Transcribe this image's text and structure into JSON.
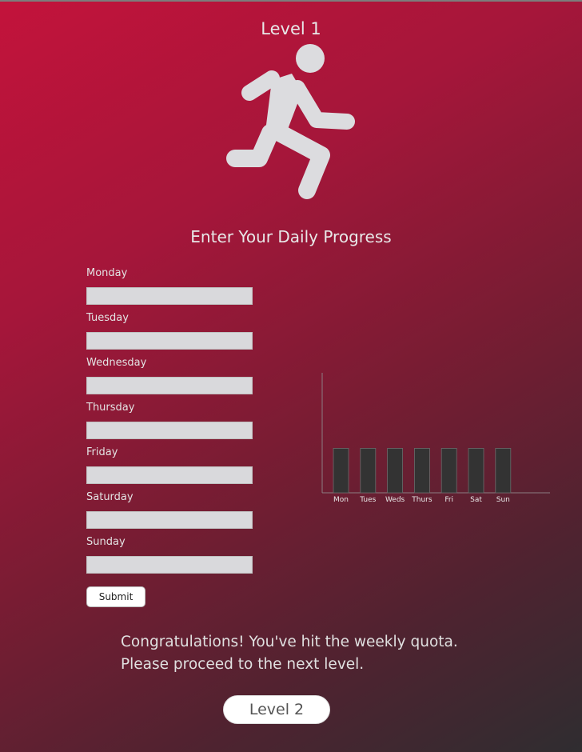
{
  "level_title": "Level 1",
  "icon": "running-person-icon",
  "heading": "Enter Your Daily Progress",
  "form": {
    "days": [
      {
        "label": "Monday",
        "value": ""
      },
      {
        "label": "Tuesday",
        "value": ""
      },
      {
        "label": "Wednesday",
        "value": ""
      },
      {
        "label": "Thursday",
        "value": ""
      },
      {
        "label": "Friday",
        "value": ""
      },
      {
        "label": "Saturday",
        "value": ""
      },
      {
        "label": "Sunday",
        "value": ""
      }
    ],
    "submit_label": "Submit"
  },
  "chart_data": {
    "type": "bar",
    "categories": [
      "Mon",
      "Tues",
      "Weds",
      "Thurs",
      "Fri",
      "Sat",
      "Sun"
    ],
    "values": [
      1,
      1,
      1,
      1,
      1,
      1,
      1
    ],
    "ylim": [
      0,
      2.7
    ],
    "title": "",
    "xlabel": "",
    "ylabel": "",
    "grid": false,
    "bar_color": "#333333"
  },
  "message": {
    "line1": "Congratulations! You've hit the weekly quota.",
    "line2": "Please proceed to the next level."
  },
  "next_button_label": "Level 2",
  "colors": {
    "gradient_start": "#c3133b",
    "gradient_end": "#2f2d30",
    "input_bg": "#d9d9dc"
  }
}
